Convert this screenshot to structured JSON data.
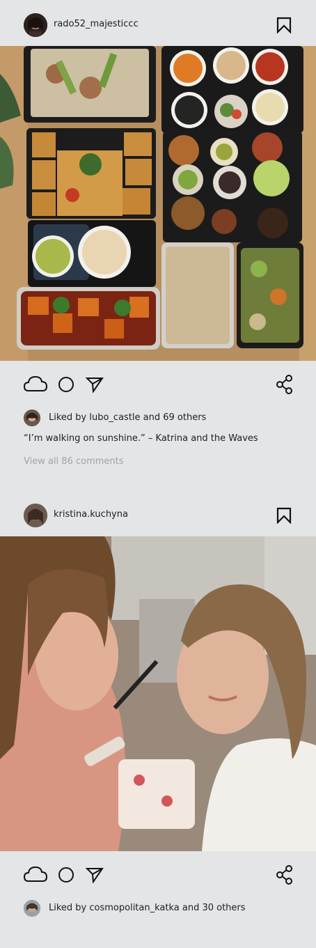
{
  "posts": [
    {
      "username": "rado52_majesticcc",
      "image_alt": "food delivery boxes",
      "likes_text": "Liked by lubo_castle and 69 others",
      "caption": "“I’m walking on sunshine.” – Katrina and the Waves",
      "comments_link": "View all 86 comments",
      "icons": [
        "heart-cloud-icon",
        "comment-circle-icon",
        "send-icon",
        "share-icon",
        "bookmark-icon"
      ]
    },
    {
      "username": "kristina.kuchyna",
      "image_alt": "makeup artist applying makeup",
      "likes_text": "Liked by cosmopolitan_katka and 30 others",
      "icons": [
        "heart-cloud-icon",
        "comment-circle-icon",
        "send-icon",
        "share-icon",
        "bookmark-icon"
      ]
    }
  ]
}
